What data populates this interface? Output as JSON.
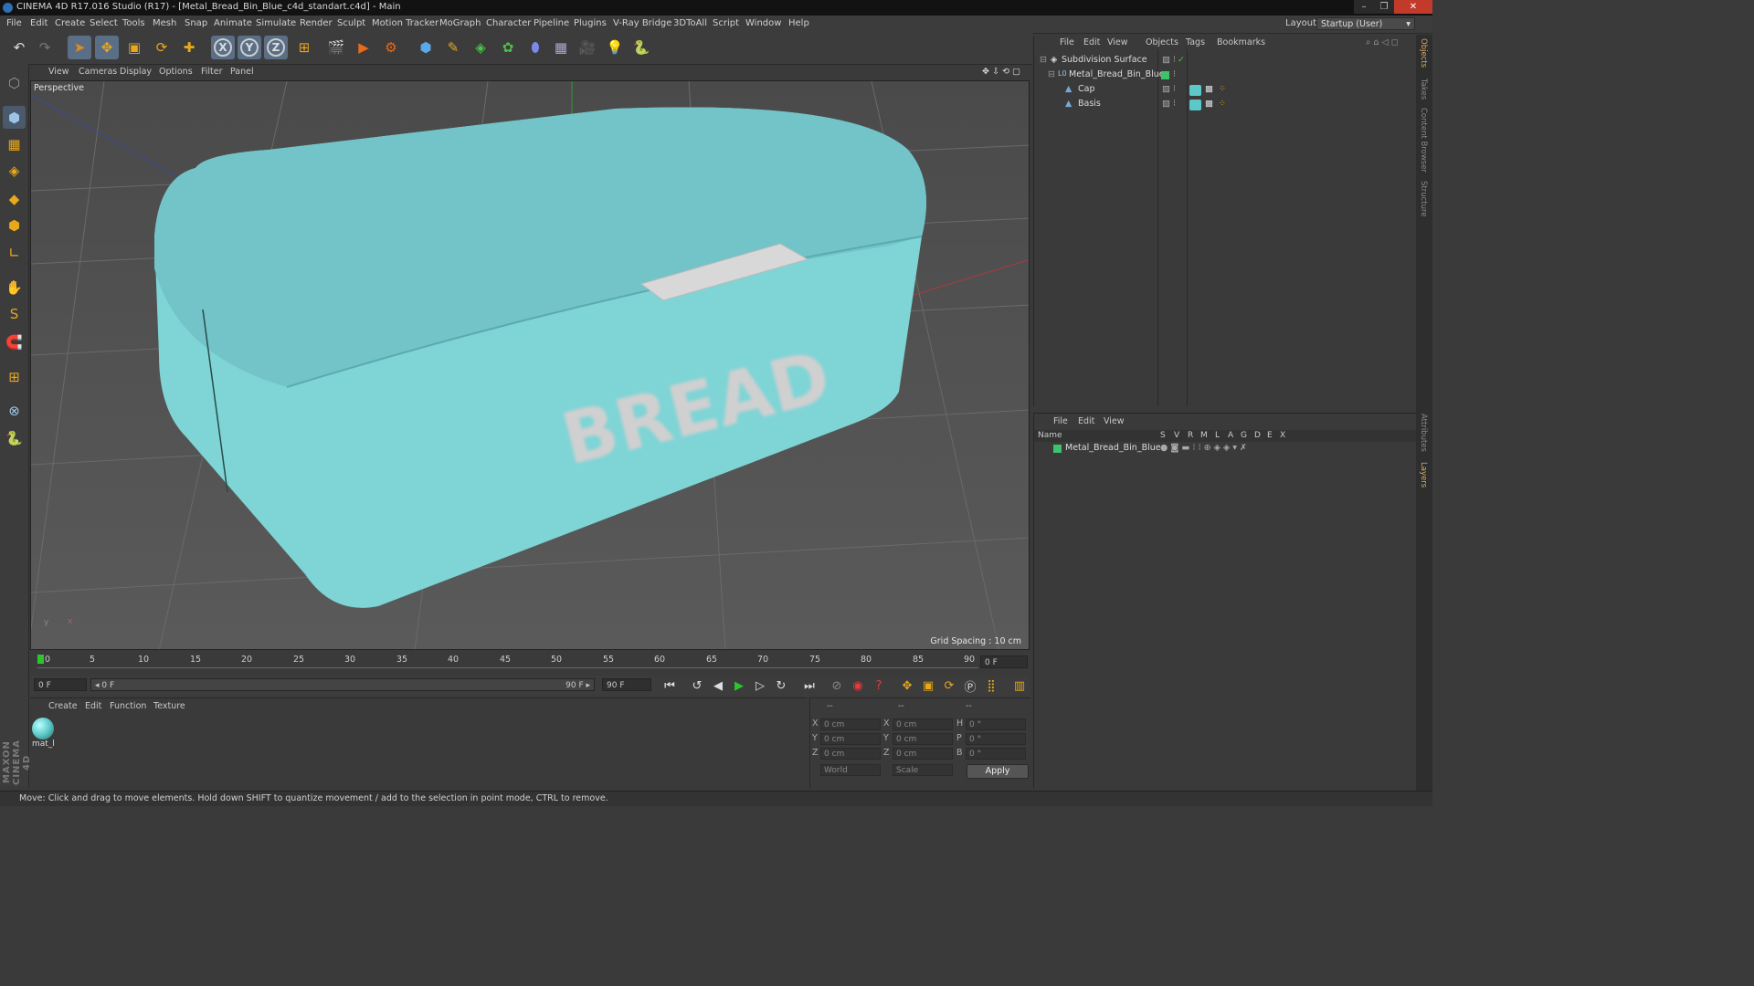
{
  "window": {
    "title": "CINEMA 4D R17.016 Studio (R17) - [Metal_Bread_Bin_Blue_c4d_standart.c4d] - Main",
    "min": "–",
    "max": "❐",
    "close": "✕"
  },
  "menu": [
    "File",
    "Edit",
    "Create",
    "Select",
    "Tools",
    "Mesh",
    "Snap",
    "Animate",
    "Simulate",
    "Render",
    "Sculpt",
    "Motion Tracker",
    "MoGraph",
    "Character",
    "Pipeline",
    "Plugins",
    "V-Ray Bridge",
    "3DToAll",
    "Script",
    "Window",
    "Help"
  ],
  "layout": {
    "label": "Layout:",
    "value": "Startup (User)"
  },
  "toolbar": {
    "undo": "↶",
    "redo": "↷",
    "select": "➤",
    "move": "✥",
    "scale": "▣",
    "rotate": "⟳",
    "add": "✚",
    "x": "X",
    "y": "Y",
    "z": "Z",
    "coord": "⊞",
    "render_view": "🎬",
    "render_pv": "▶",
    "render_settings": "⚙",
    "cube": "⬢",
    "pen": "✎",
    "subdiv": "◈",
    "mograph": "✿",
    "deformer": "⬮",
    "floor": "▦",
    "camera": "🎥",
    "light": "💡",
    "python": "🐍"
  },
  "left_tools": [
    "⬡",
    "⬢",
    "▦",
    "◈",
    "◆",
    "⬢",
    "∟",
    "✋",
    "S",
    "🧲",
    "⊞",
    "⊗",
    "🐍"
  ],
  "viewport": {
    "menu": [
      "View",
      "Cameras",
      "Display",
      "Options",
      "Filter",
      "Panel"
    ],
    "label": "Perspective",
    "grid_spacing": "Grid Spacing : 10 cm",
    "model_text": "BREAD",
    "colors": {
      "bin": "#7fd4d6",
      "bin_dark": "#5fb8bb",
      "handle": "#d8d8d8"
    },
    "axis_x": "x",
    "axis_y": "y"
  },
  "timeline": {
    "ticks": [
      "0",
      "5",
      "10",
      "15",
      "20",
      "25",
      "30",
      "35",
      "40",
      "45",
      "50",
      "55",
      "60",
      "65",
      "70",
      "75",
      "80",
      "85",
      "90"
    ],
    "current_frame": "0 F"
  },
  "playbar": {
    "start": "0 F",
    "range_start": "◂ 0 F",
    "range_end": "90 F ▸",
    "end": "90 F"
  },
  "material_manager": {
    "menu": [
      "Create",
      "Edit",
      "Function",
      "Texture"
    ],
    "materials": [
      {
        "name": "mat_l",
        "color": "#5cc8c8"
      }
    ]
  },
  "coordinates": {
    "headers": [
      "--",
      "--",
      "--"
    ],
    "rows": [
      {
        "l1": "X",
        "v1": "0 cm",
        "l2": "X",
        "v2": "0 cm",
        "l3": "H",
        "v3": "0 °"
      },
      {
        "l1": "Y",
        "v1": "0 cm",
        "l2": "Y",
        "v2": "0 cm",
        "l3": "P",
        "v3": "0 °"
      },
      {
        "l1": "Z",
        "v1": "0 cm",
        "l2": "Z",
        "v2": "0 cm",
        "l3": "B",
        "v3": "0 °"
      }
    ],
    "space": "World",
    "mode": "Scale",
    "apply": "Apply"
  },
  "object_manager": {
    "menu": [
      "File",
      "Edit",
      "View",
      "Objects",
      "Tags",
      "Bookmarks"
    ],
    "objects": [
      {
        "name": "Subdivision Surface",
        "indent": 0,
        "icon": "◈",
        "icon_color": "#4ec04e"
      },
      {
        "name": "Metal_Bread_Bin_Blue",
        "indent": 1,
        "icon": "L0",
        "icon_color": "#9cc4e8"
      },
      {
        "name": "Cap",
        "indent": 2,
        "icon": "▲",
        "icon_color": "#7aa7d8"
      },
      {
        "name": "Basis",
        "indent": 2,
        "icon": "▲",
        "icon_color": "#7aa7d8"
      }
    ]
  },
  "layer_manager": {
    "menu": [
      "File",
      "Edit",
      "View"
    ],
    "columns": [
      "Name",
      "S",
      "V",
      "R",
      "M",
      "L",
      "A",
      "G",
      "D",
      "E",
      "X"
    ],
    "layers": [
      {
        "name": "Metal_Bread_Bin_Blue",
        "color": "#3cc46a"
      }
    ]
  },
  "right_tabs": [
    "Objects",
    "Takes",
    "Content Browser",
    "Structure",
    "Attributes",
    "Layers"
  ],
  "status": "Move: Click and drag to move elements. Hold down SHIFT to quantize movement / add to the selection in point mode, CTRL to remove.",
  "branding": "MAXON CINEMA 4D"
}
